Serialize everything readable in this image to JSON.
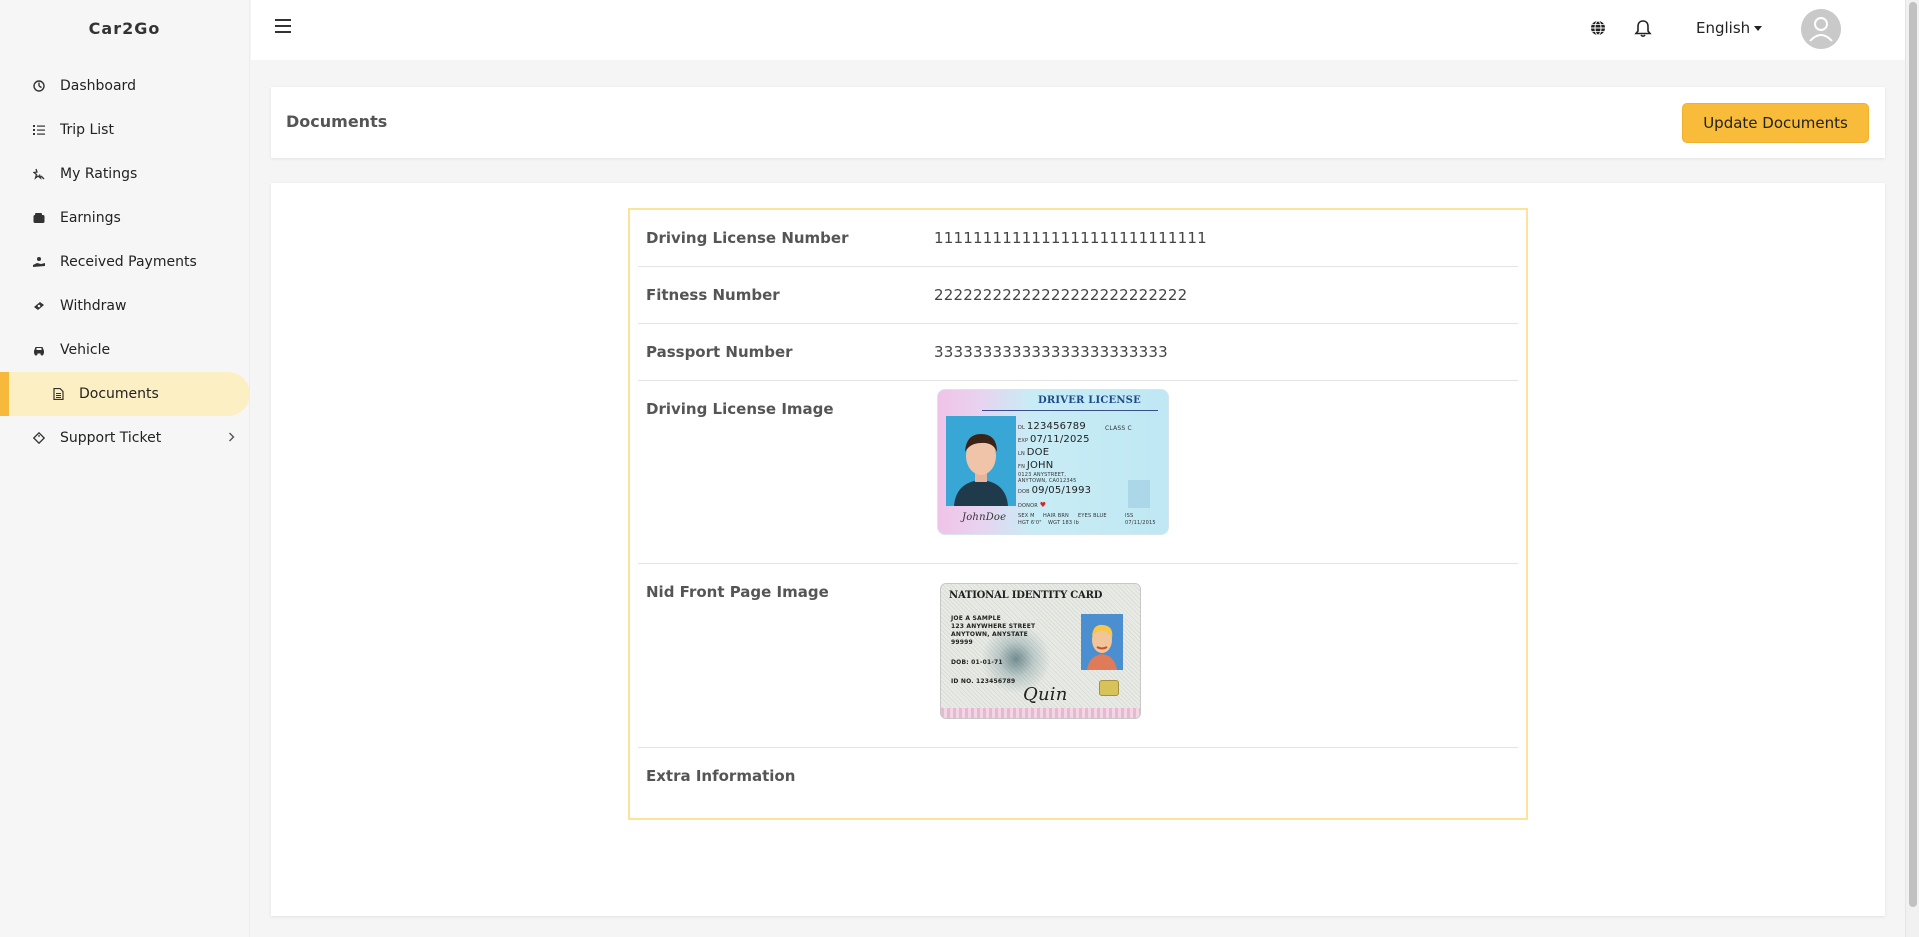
{
  "app": {
    "brand": "Car2Go"
  },
  "sidebar": {
    "items": [
      {
        "label": "Dashboard",
        "icon": "dashboard-icon"
      },
      {
        "label": "Trip List",
        "icon": "list-icon"
      },
      {
        "label": "My Ratings",
        "icon": "star-icon"
      },
      {
        "label": "Earnings",
        "icon": "wallet-icon"
      },
      {
        "label": "Received Payments",
        "icon": "hand-money-icon"
      },
      {
        "label": "Withdraw",
        "icon": "money-bill-icon"
      },
      {
        "label": "Vehicle",
        "icon": "car-icon"
      },
      {
        "label": "Documents",
        "icon": "document-icon",
        "active": true
      },
      {
        "label": "Support Ticket",
        "icon": "ticket-icon",
        "has_children": true
      }
    ]
  },
  "header": {
    "language": "English"
  },
  "page": {
    "title": "Documents",
    "update_button": "Update Documents"
  },
  "documents": {
    "driving_license_number": {
      "label": "Driving License Number",
      "value": "1111111111111111111111111111"
    },
    "fitness_number": {
      "label": "Fitness Number",
      "value": "22222222222222222222222222"
    },
    "passport_number": {
      "label": "Passport Number",
      "value": "333333333333333333333333"
    },
    "driving_license_image": {
      "label": "Driving License Image",
      "card": {
        "title": "DRIVER LICENSE",
        "dl": "123456789",
        "class": "CLASS C",
        "exp": "07/11/2025",
        "ln": "DOE",
        "fn": "JOHN",
        "address_1": "0123 ANYSTREET,",
        "address_2": "ANYTOWN, CA012345",
        "dob": "09/05/1993",
        "donor": "DONOR",
        "sex": "SEX M",
        "hair": "HAIR BRN",
        "eyes": "EYES BLUE",
        "hgt": "HGT 6'0\"",
        "wgt": "WGT 183 lb",
        "iss": "ISS",
        "iss_date": "07/11/2015",
        "signature": "JohnDoe"
      }
    },
    "nid_front_image": {
      "label": "Nid Front Page Image",
      "card": {
        "title": "NATIONAL IDENTITY CARD",
        "name": "JOE A SAMPLE",
        "street": "123 ANYWHERE STREET",
        "city": "ANYTOWN, ANYSTATE",
        "zip": "99999",
        "dob": "DOB: 01-01-71",
        "id_no": "ID NO. 123456789",
        "signature": "Quin"
      }
    },
    "extra_information": {
      "label": "Extra Information",
      "value": ""
    }
  },
  "colors": {
    "accent": "#f8bc3a",
    "active_bg": "#fdefc4",
    "table_border": "#fbe49a"
  }
}
